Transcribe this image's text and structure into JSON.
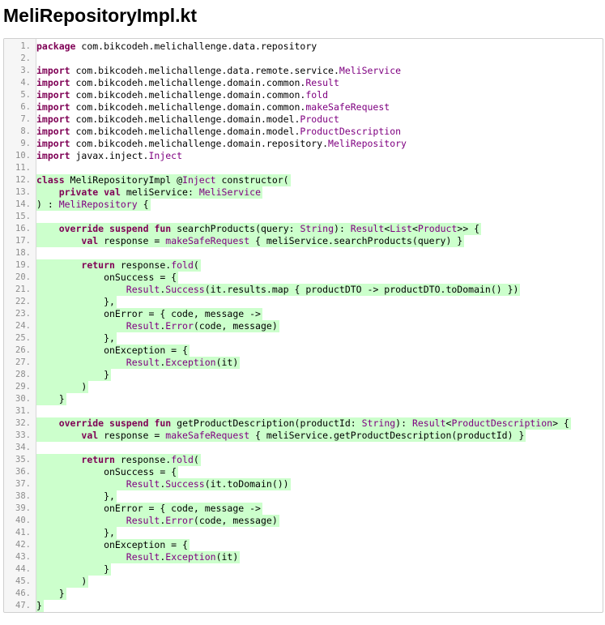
{
  "file": {
    "title": "MeliRepositoryImpl.kt",
    "line_numbers": [
      "1.",
      "2.",
      "3.",
      "4.",
      "5.",
      "6.",
      "7.",
      "8.",
      "9.",
      "10.",
      "11.",
      "12.",
      "13.",
      "14.",
      "15.",
      "16.",
      "17.",
      "18.",
      "19.",
      "20.",
      "21.",
      "22.",
      "23.",
      "24.",
      "25.",
      "26.",
      "27.",
      "28.",
      "29.",
      "30.",
      "31.",
      "32.",
      "33.",
      "34.",
      "35.",
      "36.",
      "37.",
      "38.",
      "39.",
      "40.",
      "41.",
      "42.",
      "43.",
      "44.",
      "45.",
      "46.",
      "47."
    ],
    "highlighted_lines": [
      12,
      13,
      14,
      16,
      17,
      19,
      20,
      21,
      22,
      23,
      24,
      25,
      26,
      27,
      28,
      29,
      30,
      32,
      33,
      35,
      36,
      37,
      38,
      39,
      40,
      41,
      42,
      43,
      44,
      45,
      46,
      47
    ],
    "code": [
      "package com.bikcodeh.melichallenge.data.repository",
      "",
      "import com.bikcodeh.melichallenge.data.remote.service.MeliService",
      "import com.bikcodeh.melichallenge.domain.common.Result",
      "import com.bikcodeh.melichallenge.domain.common.fold",
      "import com.bikcodeh.melichallenge.domain.common.makeSafeRequest",
      "import com.bikcodeh.melichallenge.domain.model.Product",
      "import com.bikcodeh.melichallenge.domain.model.ProductDescription",
      "import com.bikcodeh.melichallenge.domain.repository.MeliRepository",
      "import javax.inject.Inject",
      "",
      "class MeliRepositoryImpl @Inject constructor(",
      "    private val meliService: MeliService",
      ") : MeliRepository {",
      "",
      "    override suspend fun searchProducts(query: String): Result<List<Product>> {",
      "        val response = makeSafeRequest { meliService.searchProducts(query) }",
      "",
      "        return response.fold(",
      "            onSuccess = {",
      "                Result.Success(it.results.map { productDTO -> productDTO.toDomain() })",
      "            },",
      "            onError = { code, message ->",
      "                Result.Error(code, message)",
      "            },",
      "            onException = {",
      "                Result.Exception(it)",
      "            }",
      "        )",
      "    }",
      "",
      "    override suspend fun getProductDescription(productId: String): Result<ProductDescription> {",
      "        val response = makeSafeRequest { meliService.getProductDescription(productId) }",
      "",
      "        return response.fold(",
      "            onSuccess = {",
      "                Result.Success(it.toDomain())",
      "            },",
      "            onError = { code, message ->",
      "                Result.Error(code, message)",
      "            },",
      "            onException = {",
      "                Result.Exception(it)",
      "            }",
      "        )",
      "    }",
      "}"
    ]
  }
}
